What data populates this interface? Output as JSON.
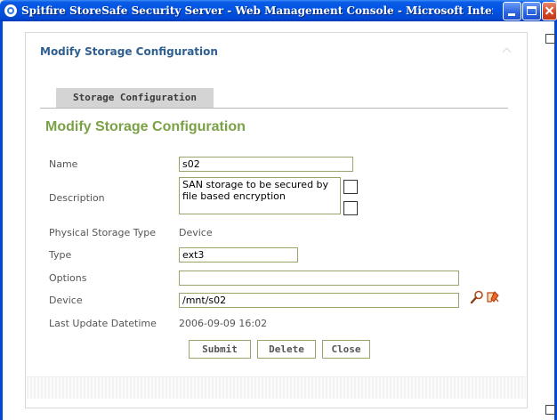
{
  "window": {
    "title": "Spitfire StoreSafe Security Server - Web Management Console - Microsoft Internet ..."
  },
  "panel": {
    "header_title": "Modify Storage Configuration",
    "tab_label": "Storage Configuration",
    "form_title": "Modify Storage Configuration"
  },
  "form": {
    "name_label": "Name",
    "name_value": "s02",
    "description_label": "Description",
    "description_value": "SAN storage to be secured by file based encryption",
    "physical_storage_type_label": "Physical Storage Type",
    "physical_storage_type_value": "Device",
    "type_label": "Type",
    "type_value": "ext3",
    "options_label": "Options",
    "options_value": "",
    "device_label": "Device",
    "device_value": "/mnt/s02",
    "last_update_label": "Last Update Datetime",
    "last_update_value": "2006-09-09 16:02"
  },
  "buttons": {
    "submit": "Submit",
    "delete": "Delete",
    "close": "Close"
  },
  "icons": {
    "browse": "magnifier-icon",
    "clear": "eraser-icon"
  },
  "colors": {
    "title_bar": "#0054e3",
    "panel_header": "#2e5f91",
    "form_title": "#7aa146",
    "field_border": "#9aa36a",
    "tab_bg": "#d4d4d4"
  }
}
